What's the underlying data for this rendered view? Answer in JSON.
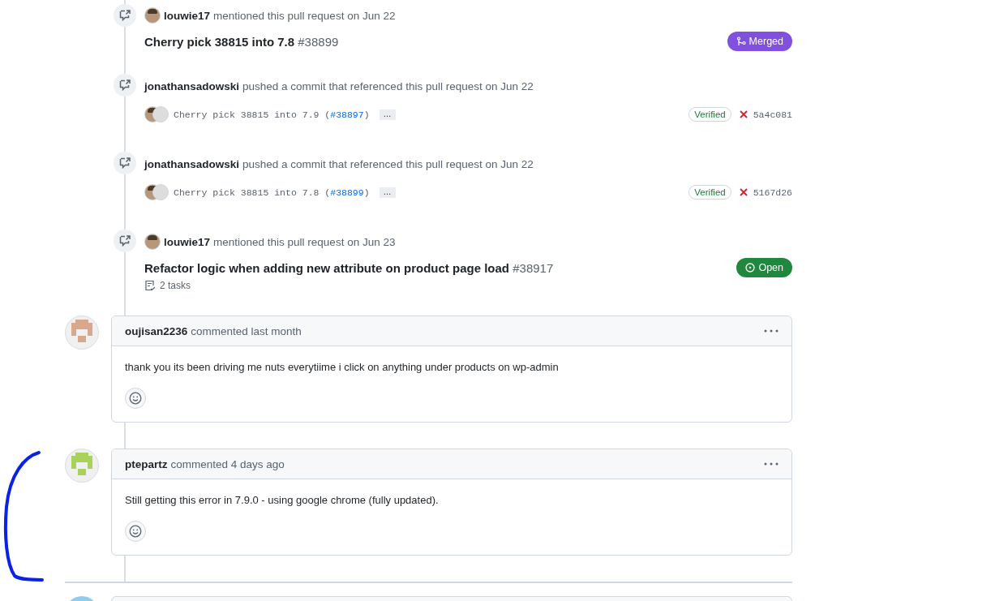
{
  "timeline": [
    {
      "kind": "mention",
      "user": "louwie17",
      "action": "mentioned this pull request on Jun 22",
      "title": "Cherry pick 38815 into 7.8",
      "number": "#38899",
      "status": {
        "kind": "merged",
        "label": "Merged"
      }
    },
    {
      "kind": "commit",
      "user": "jonathansadowski",
      "action": "pushed a commit that referenced this pull request on Jun 22",
      "message": "Cherry pick 38815 into 7.9 (",
      "link": "#38897",
      "message_end": ")",
      "more": "…",
      "verified": "Verified",
      "check_failed": true,
      "sha": "5a4c081"
    },
    {
      "kind": "commit",
      "user": "jonathansadowski",
      "action": "pushed a commit that referenced this pull request on Jun 22",
      "message": "Cherry pick 38815 into 7.8 (",
      "link": "#38899",
      "message_end": ")",
      "more": "…",
      "verified": "Verified",
      "check_failed": true,
      "sha": "5167d26"
    },
    {
      "kind": "mention",
      "user": "louwie17",
      "action": "mentioned this pull request on Jun 23",
      "title": "Refactor logic when adding new attribute on product page load",
      "number": "#38917",
      "status": {
        "kind": "open",
        "label": "Open"
      },
      "tasks": "2 tasks"
    }
  ],
  "comments": [
    {
      "user": "oujisan2236",
      "meta": "commented last month",
      "body": "thank you its been driving me nuts everytiime i click on anything under products on wp-admin",
      "color": "#d9a88c"
    },
    {
      "user": "ptepartz",
      "meta": "commented 4 days ago",
      "body": "Still getting this error in 7.9.0 - using google chrome (fully updated).",
      "color": "#a8d25a"
    }
  ]
}
